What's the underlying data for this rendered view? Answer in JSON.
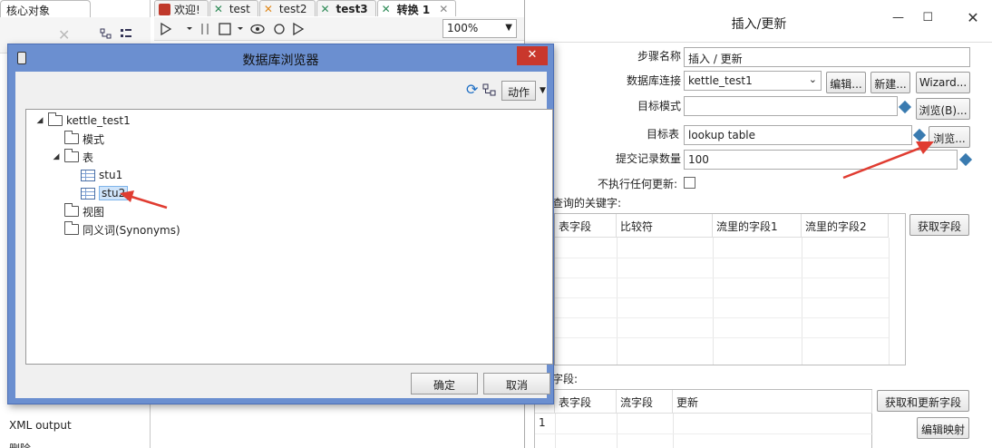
{
  "left_panel": {
    "tab_label": "核心对象",
    "items": [
      "XML output",
      "删除"
    ]
  },
  "editor_tabs": [
    {
      "label": "欢迎!",
      "active": false,
      "color": "#c0392b"
    },
    {
      "label": "test",
      "active": false,
      "color": "#2e8b57"
    },
    {
      "label": "test2",
      "active": false,
      "color": "#e08a1e"
    },
    {
      "label": "test3",
      "active": false,
      "color": "#2e8b57"
    },
    {
      "label": "转换 1",
      "active": true,
      "color": "#2e8b57"
    }
  ],
  "toolbar": {
    "zoom": "100%"
  },
  "right_dialog": {
    "title": "插入/更新",
    "step_name_label": "步骤名称",
    "step_name_value": "插入 / 更新",
    "db_conn_label": "数据库连接",
    "db_conn_value": "kettle_test1",
    "edit_btn": "编辑...",
    "new_btn": "新建...",
    "wizard_btn": "Wizard...",
    "target_schema_label": "目标模式",
    "target_schema_value": "",
    "browse_schema_btn": "浏览(B)...",
    "target_table_label": "目标表",
    "target_table_value": "lookup table",
    "browse_table_btn": "浏览...",
    "commit_label": "提交记录数量",
    "commit_value": "100",
    "no_update_label": "不执行任何更新:",
    "lookup_keys_label": "查询的关键字:",
    "lookup_headers": [
      "表字段",
      "比较符",
      "流里的字段1",
      "流里的字段2"
    ],
    "get_fields_btn": "获取字段",
    "update_fields_label": "字段:",
    "update_headers": [
      "表字段",
      "流字段",
      "更新"
    ],
    "update_rows": [
      "1"
    ],
    "get_update_btn": "获取和更新字段",
    "edit_mapping_btn": "编辑映射"
  },
  "db_browser": {
    "title": "数据库浏览器",
    "action_btn": "动作",
    "tree": {
      "root": "kettle_test1",
      "schemas": "模式",
      "tables": "表",
      "table_items": [
        "stu1",
        "stu2"
      ],
      "views": "视图",
      "synonyms": "同义词(Synonyms)"
    },
    "ok_btn": "确定",
    "cancel_btn": "取消"
  },
  "colors": {
    "title_bar": "#6b8fd0",
    "close_red": "#c9372c",
    "arrow_red": "#e03c31",
    "selection": "#cfe4fa"
  }
}
